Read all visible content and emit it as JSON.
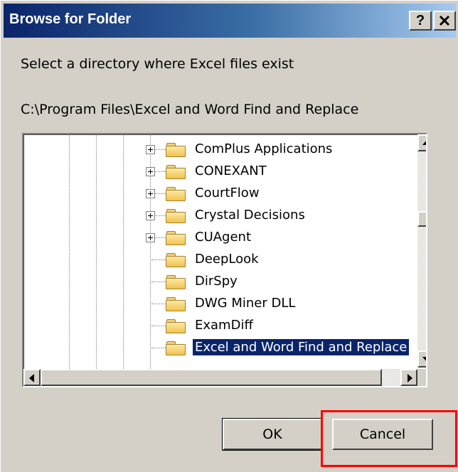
{
  "window": {
    "title": "Browse for Folder",
    "help_label": "?",
    "close_label": "X"
  },
  "instruction": "Select a directory where Excel files exist",
  "selected_path": "C:\\Program Files\\Excel and Word Find and Replace",
  "tree": {
    "items": [
      {
        "label": "ComPlus Applications",
        "expandable": true,
        "selected": false
      },
      {
        "label": "CONEXANT",
        "expandable": true,
        "selected": false
      },
      {
        "label": "CourtFlow",
        "expandable": true,
        "selected": false
      },
      {
        "label": "Crystal Decisions",
        "expandable": true,
        "selected": false
      },
      {
        "label": "CUAgent",
        "expandable": true,
        "selected": false
      },
      {
        "label": "DeepLook",
        "expandable": false,
        "selected": false
      },
      {
        "label": "DirSpy",
        "expandable": false,
        "selected": false
      },
      {
        "label": "DWG Miner DLL",
        "expandable": false,
        "selected": false
      },
      {
        "label": "ExamDiff",
        "expandable": false,
        "selected": false
      },
      {
        "label": "Excel and Word Find and Replace",
        "expandable": false,
        "selected": true
      }
    ],
    "vertical_scroll_position": 0.33
  },
  "buttons": {
    "ok": "OK",
    "cancel": "Cancel"
  },
  "colors": {
    "title_bar": "#0a246a",
    "selection": "#0a246a",
    "highlight_box": "#ff0000",
    "dialog_background": "#d4d0c8"
  },
  "icons": {
    "folder": "folder-icon",
    "expander": "plus-box-icon"
  }
}
